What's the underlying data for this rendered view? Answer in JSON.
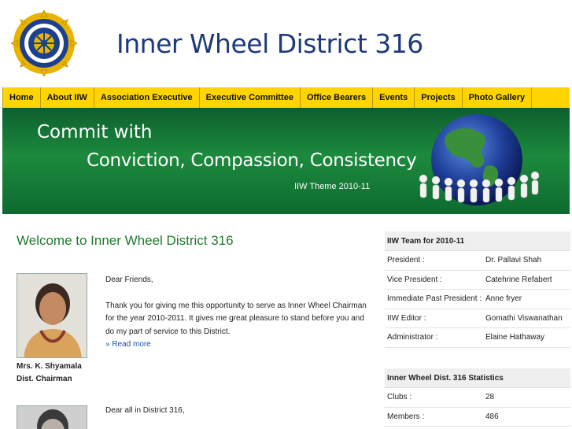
{
  "header": {
    "title": "Inner Wheel District 316"
  },
  "nav": {
    "items": [
      "Home",
      "About IIW",
      "Association Executive",
      "Executive Committee",
      "Office Bearers",
      "Events",
      "Projects",
      "Photo Gallery"
    ]
  },
  "banner": {
    "line1": "Commit with",
    "line2": "Conviction, Compassion, Consistency",
    "theme": "IIW Theme 2010-11"
  },
  "main": {
    "title": "Welcome to Inner Wheel District 316",
    "chairman": {
      "name": "Mrs. K. Shyamala",
      "role": "Dist. Chairman"
    },
    "letter": {
      "greeting": "Dear Friends,",
      "body": "Thank you for giving me this opportunity to serve as Inner Wheel Chairman for the year 2010-2011. It gives me great pleasure to stand before you and do my part of service to this District.",
      "read_more": "» Read more"
    },
    "letter2": {
      "greeting": "Dear all in District 316,"
    }
  },
  "sidebar": {
    "team": {
      "title": "IIW Team for 2010-11",
      "rows": [
        {
          "role": "President :",
          "name": "Dr. Pallavi Shah"
        },
        {
          "role": "Vice President :",
          "name": "Catehrine Refabert"
        },
        {
          "role": "Immediate Past President :",
          "name": "Anne fryer"
        },
        {
          "role": "IIW Editor :",
          "name": "Gomathi Viswanathan"
        },
        {
          "role": "Administrator :",
          "name": "Elaine Hathaway"
        }
      ]
    },
    "stats": {
      "title": "Inner Wheel Dist. 316 Statistics",
      "rows": [
        {
          "label": "Clubs :",
          "value": "28"
        },
        {
          "label": "Members :",
          "value": "486"
        }
      ]
    }
  },
  "colors": {
    "nav_bg": "#ffd400",
    "banner_green": "#1c8a3d",
    "title_blue": "#1f3a7a",
    "heading_green": "#1e7a2c",
    "link_blue": "#2255aa"
  }
}
